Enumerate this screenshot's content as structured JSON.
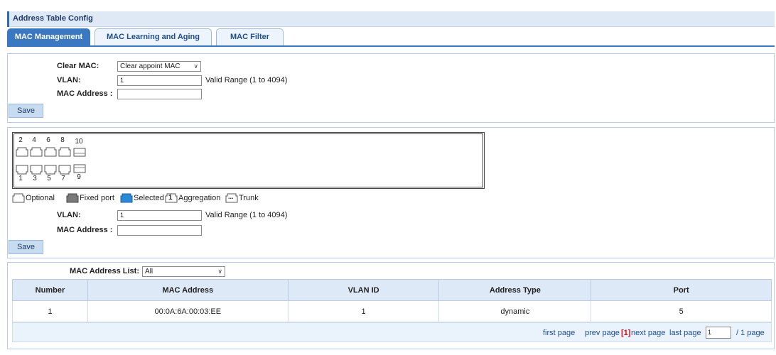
{
  "window": {
    "title": "Address Table Config"
  },
  "tabs": [
    {
      "label": "MAC Management",
      "active": true
    },
    {
      "label": "MAC Learning and Aging",
      "active": false
    },
    {
      "label": "MAC Filter",
      "active": false
    }
  ],
  "clear_section": {
    "clear_mac_label": "Clear MAC:",
    "clear_mac_value": "Clear appoint MAC",
    "vlan_label": "VLAN:",
    "vlan_value": "1",
    "vlan_note": "Valid Range (1 to 4094)",
    "mac_label": "MAC Address :",
    "mac_value": "",
    "save_label": "Save"
  },
  "port_section": {
    "top_ports": [
      "2",
      "4",
      "6",
      "8",
      "10"
    ],
    "bottom_ports": [
      "1",
      "3",
      "5",
      "7",
      "9"
    ],
    "legend": {
      "optional": "Optional",
      "fixed": "Fixed port",
      "selected": "Selected",
      "aggregation": "Aggregation",
      "aggregation_icon_text": "1",
      "trunk": "Trunk",
      "trunk_icon_text": "..."
    },
    "vlan_label": "VLAN:",
    "vlan_value": "1",
    "vlan_note": "Valid Range (1 to 4094)",
    "mac_label": "MAC Address :",
    "mac_value": "",
    "save_label": "Save"
  },
  "list_section": {
    "list_label": "MAC Address List:",
    "list_value": "All",
    "columns": [
      "Number",
      "MAC Address",
      "VLAN ID",
      "Address Type",
      "Port"
    ],
    "rows": [
      [
        "1",
        "00:0A:6A:00:03:EE",
        "1",
        "dynamic",
        "5"
      ]
    ],
    "pager": {
      "first": "first page",
      "prev": "prev page",
      "current": "[1]",
      "next": "next page",
      "last": "last page",
      "page_input": "1",
      "total": "/ 1 page"
    }
  },
  "colors": {
    "accent": "#3b78c2",
    "header_bg": "#dde9f6",
    "button_bg": "#c8dcf1"
  }
}
